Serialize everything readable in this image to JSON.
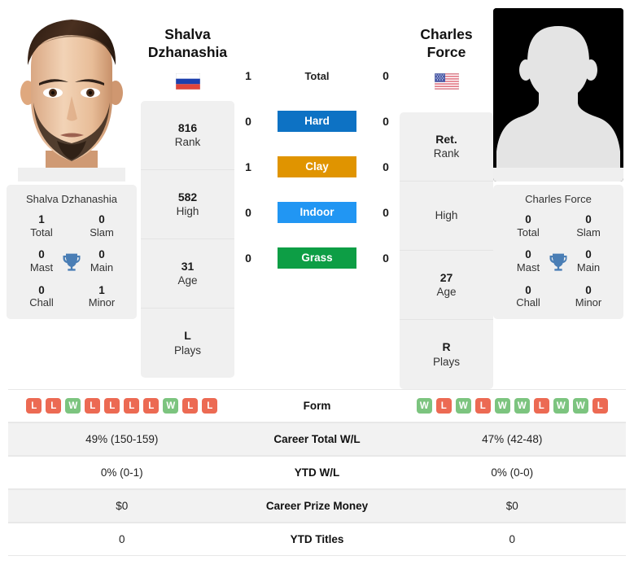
{
  "left_player": {
    "name": "Shalva Dzhanashia",
    "name_line1": "Shalva",
    "name_line2": "Dzhanashia",
    "country": "Russia",
    "flag_icon": "flag-russia-icon",
    "photo": "player-portrait-photo",
    "rank": {
      "value": "816",
      "label": "Rank"
    },
    "high": {
      "value": "582",
      "label": "High"
    },
    "age": {
      "value": "31",
      "label": "Age"
    },
    "plays": {
      "value": "L",
      "label": "Plays"
    },
    "titles": {
      "total": {
        "value": "1",
        "label": "Total"
      },
      "slam": {
        "value": "0",
        "label": "Slam"
      },
      "mast": {
        "value": "0",
        "label": "Mast"
      },
      "main": {
        "value": "0",
        "label": "Main"
      },
      "chall": {
        "value": "0",
        "label": "Chall"
      },
      "minor": {
        "value": "1",
        "label": "Minor"
      }
    },
    "form": [
      "L",
      "L",
      "W",
      "L",
      "L",
      "L",
      "L",
      "W",
      "L",
      "L"
    ],
    "career_total_wl": "49% (150-159)",
    "ytd_wl": "0% (0-1)",
    "career_prize_money": "$0",
    "ytd_titles": "0"
  },
  "right_player": {
    "name": "Charles Force",
    "name_line1": "Charles",
    "name_line2": "Force",
    "country": "United States",
    "flag_icon": "flag-usa-icon",
    "photo": "player-silhouette-placeholder",
    "rank": {
      "value": "Ret.",
      "label": "Rank"
    },
    "high": {
      "value": "",
      "label": "High"
    },
    "age": {
      "value": "27",
      "label": "Age"
    },
    "plays": {
      "value": "R",
      "label": "Plays"
    },
    "titles": {
      "total": {
        "value": "0",
        "label": "Total"
      },
      "slam": {
        "value": "0",
        "label": "Slam"
      },
      "mast": {
        "value": "0",
        "label": "Mast"
      },
      "main": {
        "value": "0",
        "label": "Main"
      },
      "chall": {
        "value": "0",
        "label": "Chall"
      },
      "minor": {
        "value": "0",
        "label": "Minor"
      }
    },
    "form": [
      "W",
      "L",
      "W",
      "L",
      "W",
      "W",
      "L",
      "W",
      "W",
      "L"
    ],
    "career_total_wl": "47% (42-48)",
    "ytd_wl": "0% (0-0)",
    "career_prize_money": "$0",
    "ytd_titles": "0"
  },
  "head_to_head": [
    {
      "label": "Total",
      "left": "1",
      "right": "0",
      "color": "",
      "style": "plain"
    },
    {
      "label": "Hard",
      "left": "0",
      "right": "0",
      "color": "#0d72c4",
      "style": "badge"
    },
    {
      "label": "Clay",
      "left": "1",
      "right": "0",
      "color": "#e09400",
      "style": "badge"
    },
    {
      "label": "Indoor",
      "left": "0",
      "right": "0",
      "color": "#2196f3",
      "style": "badge"
    },
    {
      "label": "Grass",
      "left": "0",
      "right": "0",
      "color": "#0d9e45",
      "style": "badge"
    }
  ],
  "comparison_rows": [
    {
      "label": "Form",
      "key": "form",
      "type": "form"
    },
    {
      "label": "Career Total W/L",
      "key": "career_total_wl",
      "type": "text"
    },
    {
      "label": "YTD W/L",
      "key": "ytd_wl",
      "type": "text"
    },
    {
      "label": "Career Prize Money",
      "key": "career_prize_money",
      "type": "text"
    },
    {
      "label": "YTD Titles",
      "key": "ytd_titles",
      "type": "text"
    }
  ],
  "colors": {
    "win": "#7cc47f",
    "loss": "#ec6a53",
    "card_bg": "#f0f0f0",
    "row_shaded": "#f2f2f2",
    "trophy": "#4a7eb5"
  }
}
